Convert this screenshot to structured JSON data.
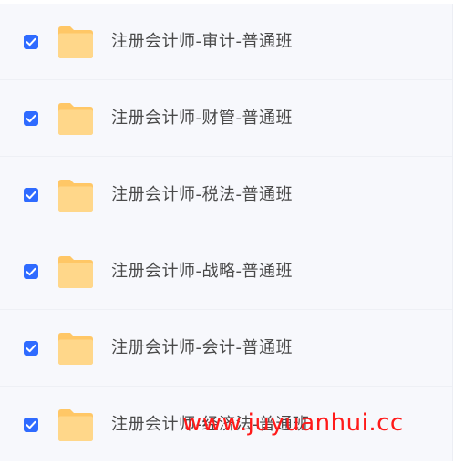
{
  "files": [
    {
      "name": "注册会计师-审计-普通班",
      "checked": true,
      "icon": "folder-icon"
    },
    {
      "name": "注册会计师-财管-普通班",
      "checked": true,
      "icon": "folder-icon"
    },
    {
      "name": "注册会计师-税法-普通班",
      "checked": true,
      "icon": "folder-icon"
    },
    {
      "name": "注册会计师-战略-普通班",
      "checked": true,
      "icon": "folder-icon"
    },
    {
      "name": "注册会计师-会计-普通班",
      "checked": true,
      "icon": "folder-icon"
    },
    {
      "name": "注册会计师-经济法-普通班",
      "checked": true,
      "icon": "folder-icon"
    }
  ],
  "watermark": "www.juyuanhui.cc",
  "colors": {
    "checkbox": "#2f6bff",
    "folder_back": "#ffc766",
    "folder_front": "#ffd78a",
    "background": "#f7f8fc",
    "watermark": "#ff1a1a"
  }
}
